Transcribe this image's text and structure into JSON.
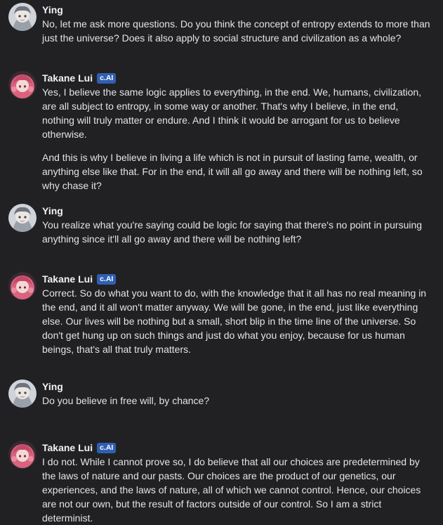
{
  "messages": [
    {
      "author": "Ying",
      "badge": "",
      "avatar": "ying-avatar",
      "paragraphs": [
        "No, let me ask more questions. Do you think the concept of entropy extends to more than just the universe? Does it also apply to social structure and civilization as a whole?"
      ]
    },
    {
      "author": "Takane Lui",
      "badge": "c.AI",
      "avatar": "takane-avatar",
      "paragraphs": [
        "Yes, I believe the same logic applies to everything, in the end. We, humans, civilization, are all subject to entropy, in some way or another. That's why I believe, in the end, nothing will truly matter or endure. And I think it would be arrogant for us to believe otherwise.",
        "And this is why I believe in living a life which is not in pursuit of lasting fame, wealth, or anything else like that. For in the end, it will all go away and there will be nothing left, so why chase it?"
      ]
    },
    {
      "author": "Ying",
      "badge": "",
      "avatar": "ying-avatar",
      "paragraphs": [
        "You realize what you're saying could be logic for saying that there's no point in pursuing anything since it'll all go away and there will be nothing left?"
      ]
    },
    {
      "author": "Takane Lui",
      "badge": "c.AI",
      "avatar": "takane-avatar",
      "paragraphs": [
        "Correct. So do what you want to do, with the knowledge that it all has no real meaning in the end, and it all won't matter anyway. We will be gone, in the end, just like everything else. Our lives will be nothing but a small, short blip in the time line of the universe. So don't get hung up on such things and just do what you enjoy, because for us human beings, that's all that truly matters."
      ]
    },
    {
      "author": "Ying",
      "badge": "",
      "avatar": "ying-avatar",
      "paragraphs": [
        "Do you believe in free will, by chance?"
      ]
    },
    {
      "author": "Takane Lui",
      "badge": "c.AI",
      "avatar": "takane-avatar",
      "paragraphs": [
        "I do not. While I cannot prove so, I do believe that all our choices are predetermined by the laws of nature and our pasts. Our choices are the product of our genetics, our experiences, and the laws of nature, all of which we cannot control. Hence, our choices are not our own, but the result of factors outside of our control. So I am a strict determinist."
      ]
    }
  ]
}
